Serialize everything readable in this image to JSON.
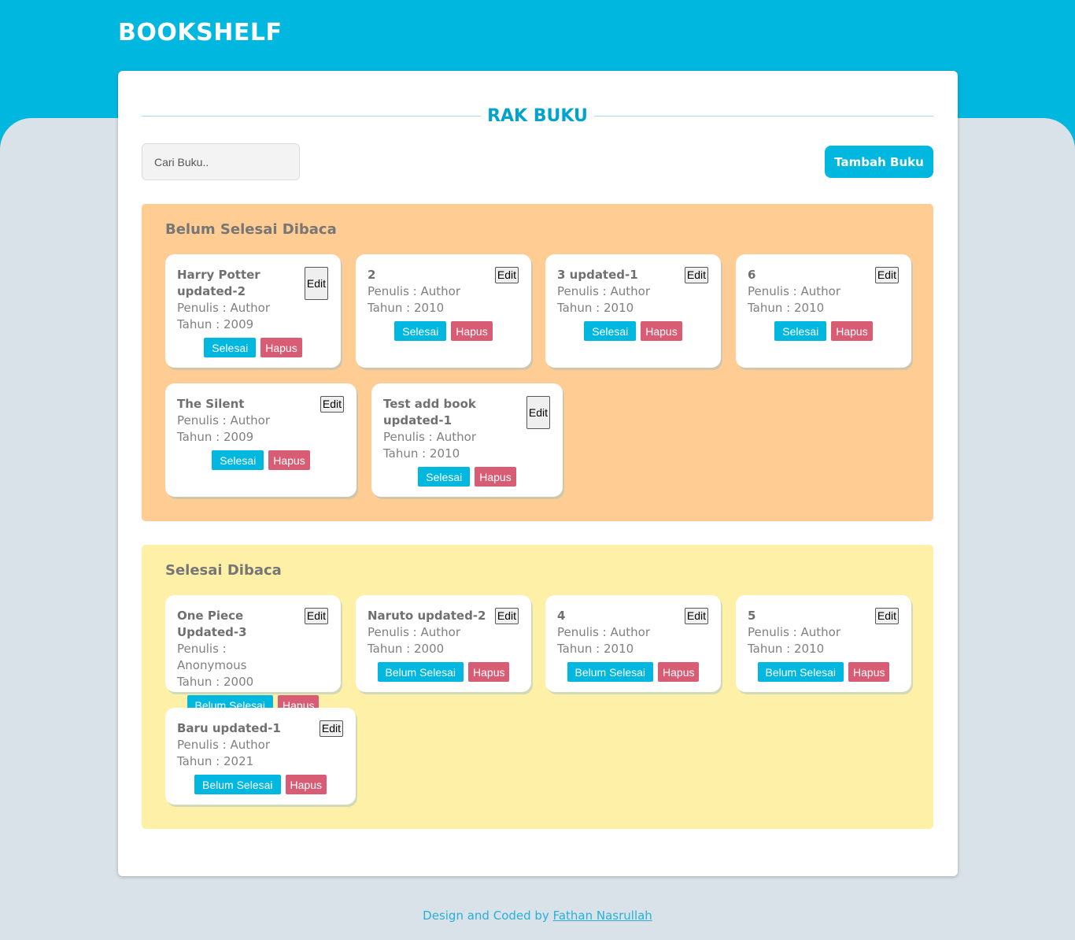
{
  "header": {
    "logo": "BOOKSHELF",
    "accent": "#00b7e0"
  },
  "main": {
    "heading": "RAK BUKU",
    "search": {
      "placeholder": "Cari Buku..",
      "value": ""
    },
    "add_button": "Tambah Buku"
  },
  "shelves": {
    "unread": {
      "title": "Belum Selesai Dibaca",
      "color": "#ffcc94",
      "books": [
        {
          "title": "Harry Potter updated-2",
          "author": "Penulis : Author",
          "year": "Tahun : 2009",
          "toggle": "Selesai",
          "delete": "Hapus",
          "edit": "Edit"
        },
        {
          "title": "2",
          "author": "Penulis : Author",
          "year": "Tahun : 2010",
          "toggle": "Selesai",
          "delete": "Hapus",
          "edit": "Edit"
        },
        {
          "title": "3 updated-1",
          "author": "Penulis : Author",
          "year": "Tahun : 2010",
          "toggle": "Selesai",
          "delete": "Hapus",
          "edit": "Edit"
        },
        {
          "title": "6",
          "author": "Penulis : Author",
          "year": "Tahun : 2010",
          "toggle": "Selesai",
          "delete": "Hapus",
          "edit": "Edit"
        },
        {
          "title": "The Silent",
          "author": "Penulis : Author",
          "year": "Tahun : 2009",
          "toggle": "Selesai",
          "delete": "Hapus",
          "edit": "Edit"
        },
        {
          "title": "Test add book updated-1",
          "author": "Penulis : Author",
          "year": "Tahun : 2010",
          "toggle": "Selesai",
          "delete": "Hapus",
          "edit": "Edit"
        }
      ]
    },
    "read": {
      "title": "Selesai Dibaca",
      "color": "#fff0a8",
      "books": [
        {
          "title": "One Piece Updated-3",
          "author": "Penulis : Anonymous",
          "year": "Tahun : 2000",
          "toggle": "Belum Selesai",
          "delete": "Hapus",
          "edit": "Edit"
        },
        {
          "title": "Naruto updated-2",
          "author": "Penulis : Author",
          "year": "Tahun : 2000",
          "toggle": "Belum Selesai",
          "delete": "Hapus",
          "edit": "Edit"
        },
        {
          "title": "4",
          "author": "Penulis : Author",
          "year": "Tahun : 2010",
          "toggle": "Belum Selesai",
          "delete": "Hapus",
          "edit": "Edit"
        },
        {
          "title": "5",
          "author": "Penulis : Author",
          "year": "Tahun : 2010",
          "toggle": "Belum Selesai",
          "delete": "Hapus",
          "edit": "Edit"
        },
        {
          "title": "Baru updated-1",
          "author": "Penulis : Author",
          "year": "Tahun : 2021",
          "toggle": "Belum Selesai",
          "delete": "Hapus",
          "edit": "Edit"
        }
      ]
    }
  },
  "footer": {
    "text": "Design and Coded by ",
    "author_link": "Fathan Nasrullah"
  }
}
